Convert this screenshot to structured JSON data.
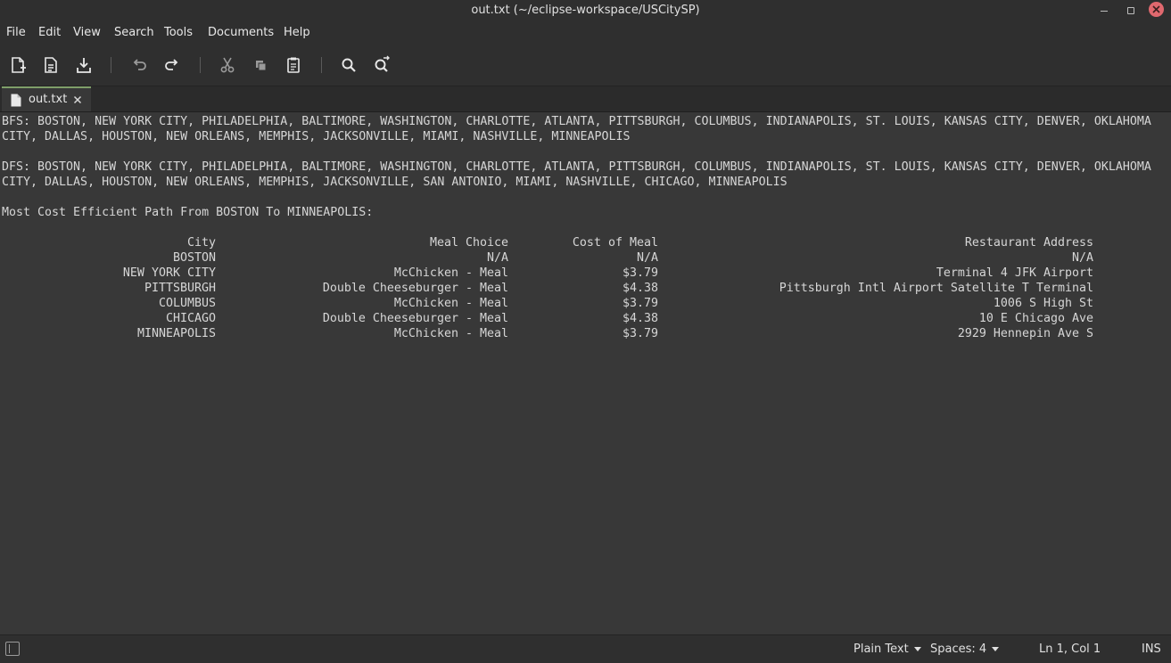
{
  "window": {
    "title": "out.txt (~/eclipse-workspace/USCitySP)"
  },
  "menu": [
    "File",
    "Edit",
    "View",
    "Search",
    "Tools",
    "Documents",
    "Help"
  ],
  "toolbar": {
    "icons": [
      "new-document-icon",
      "open-document-icon",
      "save-document-icon",
      "undo-icon",
      "redo-icon",
      "cut-icon",
      "copy-icon",
      "paste-icon",
      "find-icon",
      "find-replace-icon"
    ]
  },
  "tab": {
    "label": "out.txt"
  },
  "editor": {
    "bfs_line1": "BFS: BOSTON, NEW YORK CITY, PHILADELPHIA, BALTIMORE, WASHINGTON, CHARLOTTE, ATLANTA, PITTSBURGH, COLUMBUS, INDIANAPOLIS, ST. LOUIS, KANSAS CITY, DENVER, OKLAHOMA",
    "bfs_line2": "CITY, DALLAS, HOUSTON, NEW ORLEANS, MEMPHIS, JACKSONVILLE, MIAMI, NASHVILLE, MINNEAPOLIS",
    "dfs_line1": "DFS: BOSTON, NEW YORK CITY, PHILADELPHIA, BALTIMORE, WASHINGTON, CHARLOTTE, ATLANTA, PITTSBURGH, COLUMBUS, INDIANAPOLIS, ST. LOUIS, KANSAS CITY, DENVER, OKLAHOMA",
    "dfs_line2": "CITY, DALLAS, HOUSTON, NEW ORLEANS, MEMPHIS, JACKSONVILLE, SAN ANTONIO, MIAMI, NASHVILLE, CHICAGO, MINNEAPOLIS",
    "path_heading": "Most Cost Efficient Path From BOSTON To MINNEAPOLIS:",
    "table": {
      "headers": [
        "City",
        "Meal Choice",
        "Cost of Meal",
        "Restaurant Address"
      ],
      "rows": [
        [
          "BOSTON",
          "N/A",
          "N/A",
          "N/A"
        ],
        [
          "NEW YORK CITY",
          "McChicken - Meal",
          "$3.79",
          "Terminal 4 JFK Airport"
        ],
        [
          "PITTSBURGH",
          "Double Cheeseburger - Meal",
          "$4.38",
          "Pittsburgh Intl Airport Satellite T Terminal"
        ],
        [
          "COLUMBUS",
          "McChicken - Meal",
          "$3.79",
          "1006 S High St"
        ],
        [
          "CHICAGO",
          "Double Cheeseburger - Meal",
          "$4.38",
          "10 E Chicago Ave"
        ],
        [
          "MINNEAPOLIS",
          "McChicken - Meal",
          "$3.79",
          "2929 Hennepin Ave S"
        ]
      ]
    }
  },
  "status": {
    "syntax": "Plain Text",
    "indent": "Spaces: 4",
    "position": "Ln 1, Col 1",
    "mode": "INS"
  }
}
